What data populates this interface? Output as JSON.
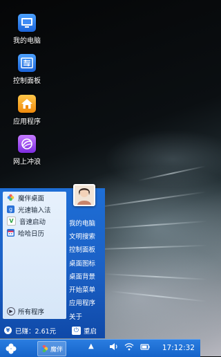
{
  "desktop": {
    "icons": [
      {
        "label": "我的电脑",
        "icon": "computer-icon",
        "color": "#2f7ff0"
      },
      {
        "label": "控制面板",
        "icon": "control-panel-icon",
        "color": "#2f7ff0"
      },
      {
        "label": "应用程序",
        "icon": "home-icon",
        "color": "#f5a623"
      },
      {
        "label": "网上冲浪",
        "icon": "browser-icon",
        "color": "#9a4df0"
      }
    ]
  },
  "start_menu": {
    "programs": [
      {
        "label": "魔伴桌面",
        "icon": "flower-icon"
      },
      {
        "label": "光速输入法",
        "icon": "keyboard-g-icon"
      },
      {
        "label": "音速启动",
        "icon": "v-icon"
      },
      {
        "label": "哈哈日历",
        "icon": "calendar-icon"
      }
    ],
    "all_programs": "所有程序",
    "links": [
      "我的电脑",
      "文明搜索",
      "控制面板",
      "桌面图标",
      "桌面背景",
      "开始菜单",
      "应用程序",
      "关于"
    ],
    "earned": "已赚：2.61元",
    "restart": "重启"
  },
  "taskbar": {
    "app_label": "魔伴",
    "time": "17:12:32",
    "accent": "#1a6bd0"
  }
}
